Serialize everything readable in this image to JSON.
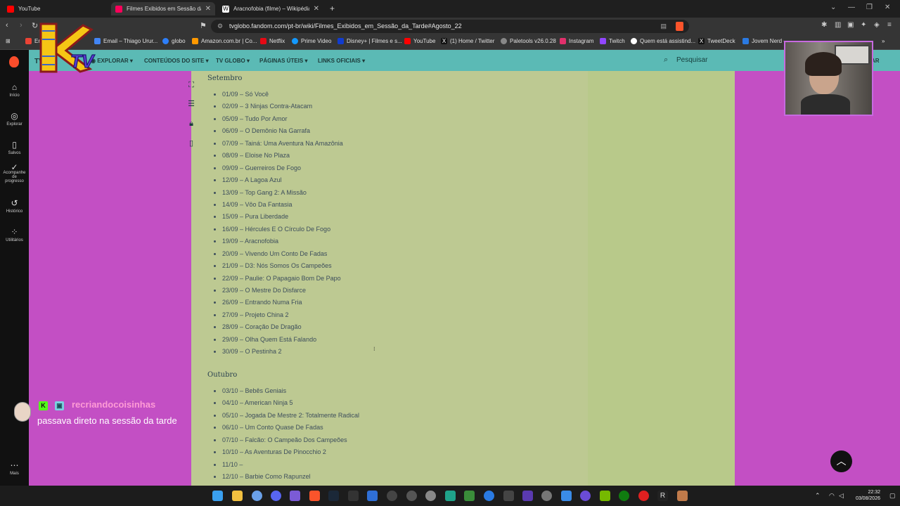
{
  "browser": {
    "tabs": [
      {
        "title": "YouTube",
        "active": false,
        "icon": "youtube-icon",
        "color": "#ff0000"
      },
      {
        "title": "Filmes Exibidos em Sessão da Ta",
        "active": true,
        "icon": "fandom-icon",
        "color": "#fa005a"
      },
      {
        "title": "Aracnofobia (filme) – Wikipédia, a en",
        "active": false,
        "icon": "wikipedia-icon",
        "color": "#ffffff"
      }
    ],
    "new_tab": "+",
    "url": "tvglobo.fandom.com/pt-br/wiki/Filmes_Exibidos_em_Sessão_da_Tarde#Agosto_22",
    "bookmarks": [
      {
        "label": "Em",
        "color": "#ea4335"
      },
      {
        "label": "Email – Thiago Urur...",
        "color": "#4285f4"
      },
      {
        "label": "globo",
        "color": "#2d7ff9"
      },
      {
        "label": "Amazon.com.br | Co...",
        "color": "#ff9900"
      },
      {
        "label": "Netflix",
        "color": "#e50914"
      },
      {
        "label": "Prime Video",
        "color": "#1399ff"
      },
      {
        "label": "Disney+ | Filmes e s...",
        "color": "#113ccf"
      },
      {
        "label": "YouTube",
        "color": "#ff0000"
      },
      {
        "label": "(1) Home / Twitter",
        "color": "#111111"
      },
      {
        "label": "Paletools v26.0.28",
        "color": "#888888"
      },
      {
        "label": "Instagram",
        "color": "#e1306c"
      },
      {
        "label": "Twitch",
        "color": "#9146ff"
      },
      {
        "label": "Quem está assistind...",
        "color": "#ffffff"
      },
      {
        "label": "TweetDeck",
        "color": "#111111"
      },
      {
        "label": "Jovem Nerd – ...",
        "color": "#2a7ae2"
      }
    ]
  },
  "sidebar": {
    "items": [
      {
        "label": "Início",
        "icon": "home-icon"
      },
      {
        "label": "Explorar",
        "icon": "compass-icon"
      },
      {
        "label": "Salvos",
        "icon": "bookmark-icon"
      },
      {
        "label": "Acompanhe\nde\nprogresso",
        "icon": "check-circle-icon"
      },
      {
        "label": "Histórico",
        "icon": "history-icon"
      },
      {
        "label": "Utilitários",
        "icon": "grid-icon"
      }
    ],
    "more_label": "Mais"
  },
  "site_nav": {
    "brand": "TV",
    "items": [
      "EXPLORAR",
      "CONTEÚDOS DO SITE",
      "TV GLOBO",
      "PÁGINAS ÚTEIS",
      "LINKS OFICIAIS"
    ],
    "search_placeholder": "Pesquisar",
    "right_label": "AR"
  },
  "sections": [
    {
      "title": "Setembro",
      "films": [
        "01/09 – Só Você",
        "02/09 – 3 Ninjas Contra-Atacam",
        "05/09 – Tudo Por Amor",
        "06/09 – O Demônio Na Garrafa",
        "07/09 – Tainá: Uma Aventura Na Amazônia",
        "08/09 – Eloise No Plaza",
        "09/09 – Guerreiros De Fogo",
        "12/09 – A Lagoa Azul",
        "13/09 – Top Gang 2: A Missão",
        "14/09 – Vôo Da Fantasia",
        "15/09 – Pura Liberdade",
        "16/09 – Hércules E O Círculo De Fogo",
        "19/09 – Aracnofobia",
        "20/09 – Vivendo Um Conto De Fadas",
        "21/09 – D3: Nós Somos Os Campeões",
        "22/09 – Paulie: O Papagaio Bom De Papo",
        "23/09 – O Mestre Do Disfarce",
        "26/09 – Entrando Numa Fria",
        "27/09 – Projeto China 2",
        "28/09 – Coração De Dragão",
        "29/09 – Olha Quem Está Falando",
        "30/09 – O Pestinha 2"
      ]
    },
    {
      "title": "Outubro",
      "films": [
        "03/10 – Bebês Geniais",
        "04/10 – American Ninja 5",
        "05/10 – Jogada De Mestre 2: Totalmente Radical",
        "06/10 – Um Conto Quase De Fadas",
        "07/10 – Falcão: O Campeão Dos Campeões",
        "10/10 – As Aventuras De Pinocchio 2",
        "11/10 –",
        "12/10 – Barbie Como Rapunzel"
      ]
    }
  ],
  "chat": {
    "username": "recriandocoisinhas",
    "message": "passava direto na sessão da tarde",
    "username_color": "#ff9bd6"
  },
  "overlay": {
    "logo_text_k": "K",
    "logo_text_tv": "TV"
  },
  "taskbar": {
    "time": "22:32",
    "date": "03/08/2026"
  }
}
